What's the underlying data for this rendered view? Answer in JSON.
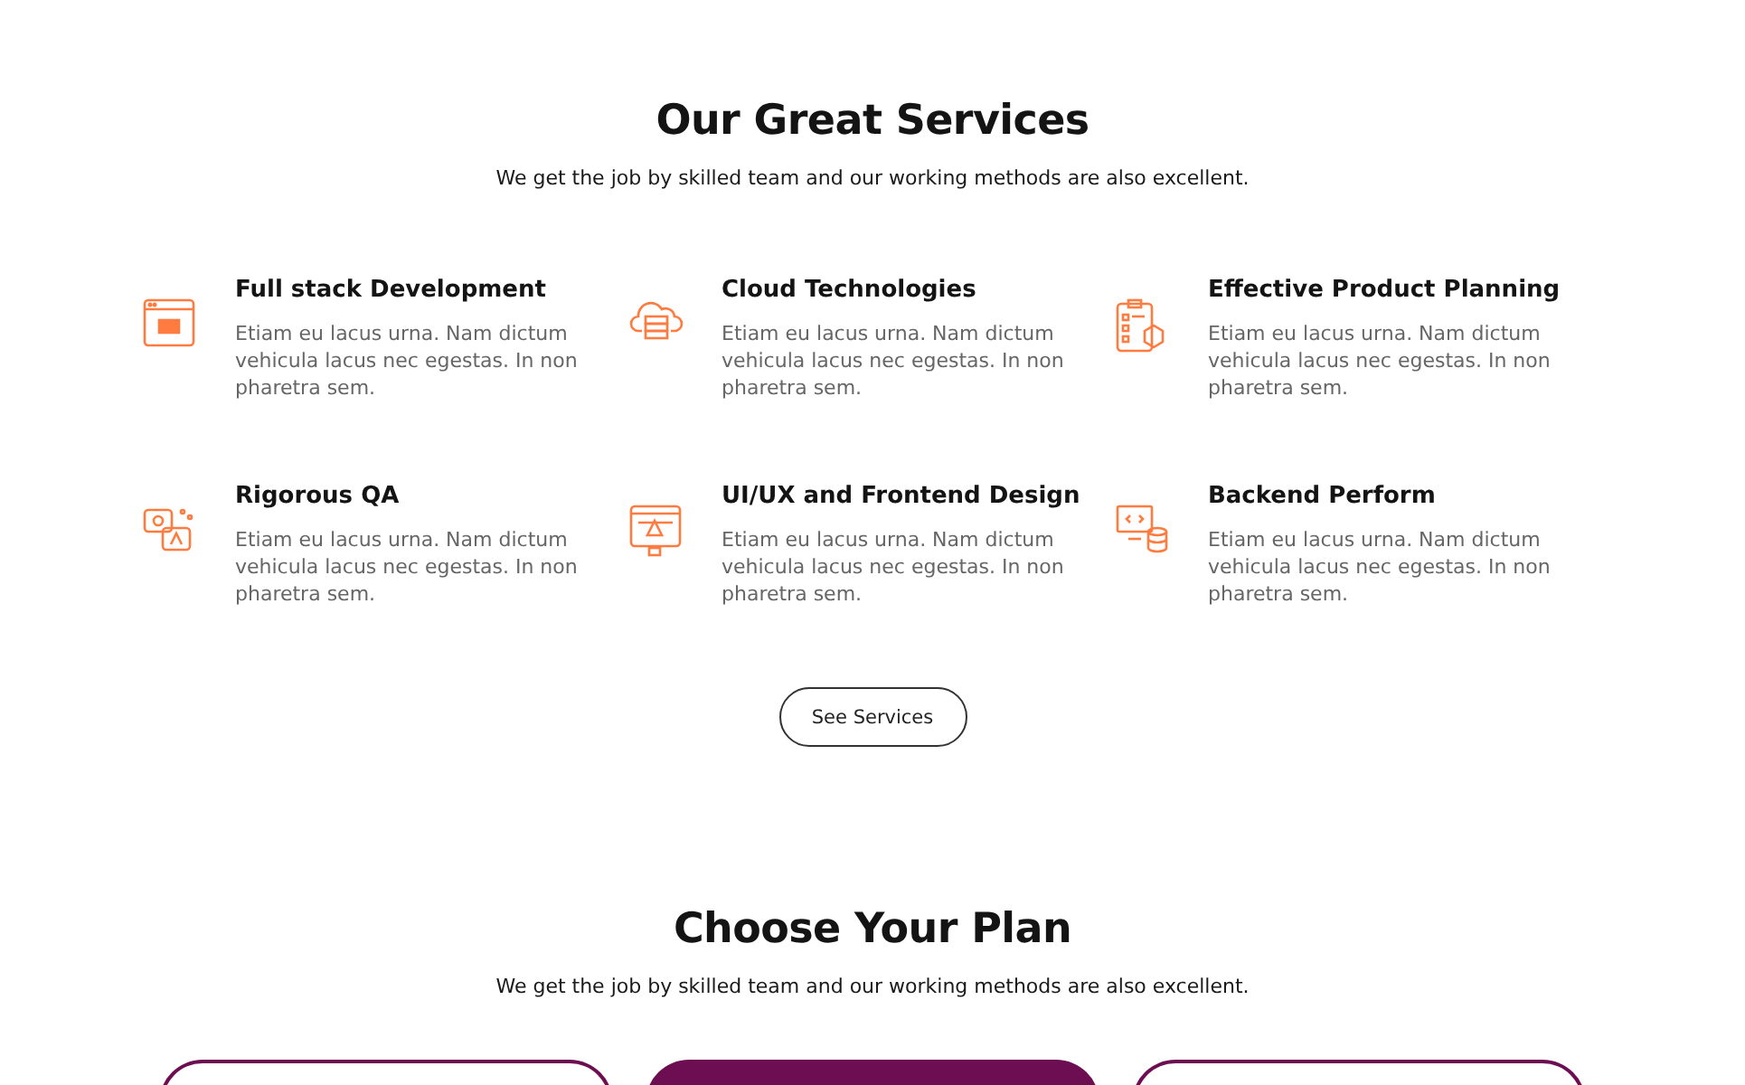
{
  "services_section": {
    "title": "Our Great Services",
    "subtitle": "We get the job by skilled team and our working methods are also excellent.",
    "services": [
      {
        "title": "Full stack Development",
        "description": "Etiam eu lacus urna. Nam dictum vehicula lacus nec egestas. In non pharetra sem."
      },
      {
        "title": "Cloud Technologies",
        "description": "Etiam eu lacus urna. Nam dictum vehicula lacus nec egestas. In non pharetra sem."
      },
      {
        "title": "Effective Product Planning",
        "description": "Etiam eu lacus urna. Nam dictum vehicula lacus nec egestas. In non pharetra sem."
      },
      {
        "title": "Rigorous QA",
        "description": "Etiam eu lacus urna. Nam dictum vehicula lacus nec egestas. In non pharetra sem."
      },
      {
        "title": "UI/UX and Frontend Design",
        "description": "Etiam eu lacus urna. Nam dictum vehicula lacus nec egestas. In non pharetra sem."
      },
      {
        "title": "Backend Perform",
        "description": "Etiam eu lacus urna. Nam dictum vehicula lacus nec egestas. In non pharetra sem."
      }
    ],
    "button": "See Services"
  },
  "plans_section": {
    "title": "Choose Your Plan",
    "subtitle": "We get the job by skilled team and our working methods are also excellent.",
    "plans": [
      {
        "selected": false
      },
      {
        "selected": true
      },
      {
        "selected": false
      }
    ]
  }
}
